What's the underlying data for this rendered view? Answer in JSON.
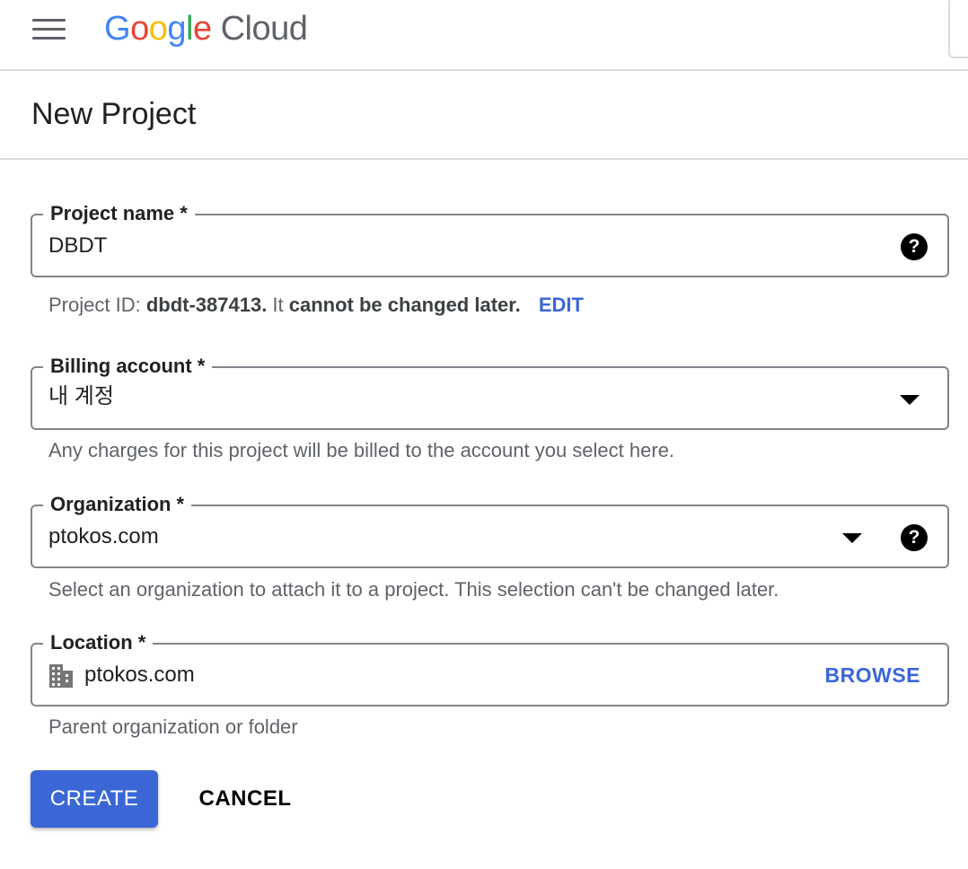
{
  "topbar": {
    "logo_parts": [
      "G",
      "o",
      "o",
      "g",
      "l",
      "e"
    ],
    "logo_product": "Cloud",
    "colors": {
      "blue": "#4285f4",
      "red": "#ea4335",
      "yellow": "#fbbc05",
      "green": "#34a853"
    }
  },
  "page": {
    "title": "New Project"
  },
  "project_name": {
    "label": "Project name *",
    "value": "DBDT",
    "help_icon": "help-icon"
  },
  "project_id_hint": {
    "prefix": "Project ID: ",
    "id": "dbdt-387413.",
    "middle": " It ",
    "emphasis": "cannot be changed later.",
    "edit_label": "EDIT"
  },
  "billing_account": {
    "label": "Billing account *",
    "value": "내 계정",
    "hint": "Any charges for this project will be billed to the account you select here."
  },
  "organization": {
    "label": "Organization *",
    "value": "ptokos.com",
    "hint": "Select an organization to attach it to a project. This selection can't be changed later."
  },
  "location": {
    "label": "Location *",
    "value": "ptokos.com",
    "browse_label": "BROWSE",
    "hint": "Parent organization or folder",
    "icon": "building-icon"
  },
  "actions": {
    "create_label": "CREATE",
    "cancel_label": "CANCEL",
    "accent": "#3b67d6"
  }
}
